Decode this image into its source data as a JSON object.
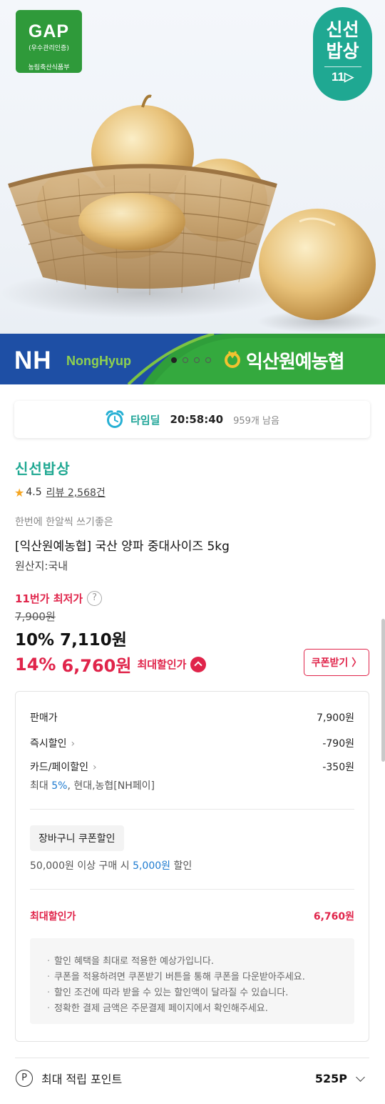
{
  "hero": {
    "gap_title": "GAP",
    "gap_sub": "(우수관리인증)",
    "gap_foot": "농림축산식품부",
    "fresh_line1": "신선",
    "fresh_line2": "밥상",
    "fresh_line3": "11▷",
    "nh_logo": "NH",
    "nh_name": "NongHyup",
    "coop_name": "익산원예농협",
    "carousel_total": 4,
    "carousel_active": 1
  },
  "timedeal": {
    "label": "타임딜",
    "time": "20:58:40",
    "remaining": "959개 남음",
    "icon": "alarm-clock-icon"
  },
  "product": {
    "brand": "신선밥상",
    "rating": "4.5",
    "review": "리뷰 2,568건",
    "subtitle": "한번에 한알씩 쓰기좋은",
    "title": "[익산원예농협] 국산 양파 중대사이즈 5kg",
    "origin": "원산지:국내"
  },
  "price": {
    "lowest_label": "11번가 최저가",
    "original": "7,900원",
    "sale": "10% 7,110원",
    "max_pct": "14%",
    "max_price": "6,760원",
    "max_label": "최대할인가",
    "coupon_button": "쿠폰받기 〉"
  },
  "detail": {
    "sell_label": "판매가",
    "sell_value": "7,900원",
    "instant_label": "즉시할인",
    "instant_value": "-790원",
    "card_label": "카드/페이할인",
    "card_value": "-350원",
    "card_note_prefix": "최대 ",
    "card_note_pct": "5%",
    "card_note_suffix": ", 현대,농협[NH페이]",
    "cart_tag": "장바구니 쿠폰할인",
    "cart_note_prefix": "50,000원 이상 구매 시 ",
    "cart_note_amount": "5,000원",
    "cart_note_suffix": " 할인",
    "max_label": "최대할인가",
    "max_value": "6,760원",
    "notices": [
      "할인 혜택을 최대로 적용한 예상가입니다.",
      "쿠폰을 적용하려면 쿠폰받기 버튼을 통해 쿠폰을 다운받아주세요.",
      "할인 조건에 따라 받을 수 있는 할인액이 달라질 수 있습니다.",
      "정확한 결제 금액은 주문결제 페이지에서 확인해주세요."
    ]
  },
  "points": {
    "icon_letter": "P",
    "label": "최대 적립 포인트",
    "value": "525P"
  },
  "colors": {
    "accent_red": "#e0244a",
    "brand_teal": "#1fa892",
    "gap_green": "#2f9a3a",
    "nh_blue": "#1e4fa5",
    "link_blue": "#1e7bd0"
  }
}
